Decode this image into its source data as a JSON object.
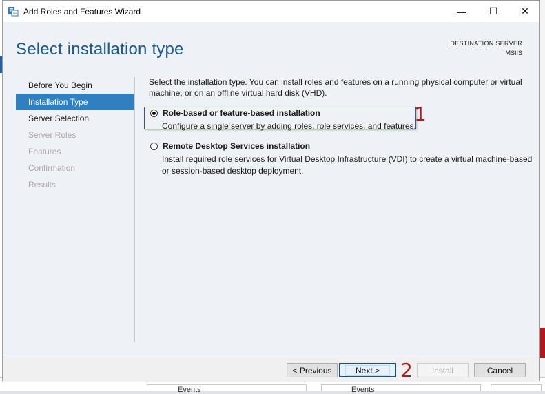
{
  "window": {
    "title": "Add Roles and Features Wizard",
    "controls": {
      "minimize": "—",
      "maximize": "☐",
      "close": "✕"
    }
  },
  "header": {
    "page_title": "Select installation type",
    "destination_label": "DESTINATION SERVER",
    "destination_name": "MSIIS"
  },
  "nav": {
    "items": [
      {
        "label": "Before You Begin",
        "state": "done"
      },
      {
        "label": "Installation Type",
        "state": "active"
      },
      {
        "label": "Server Selection",
        "state": "current"
      },
      {
        "label": "Server Roles",
        "state": "disabled"
      },
      {
        "label": "Features",
        "state": "disabled"
      },
      {
        "label": "Confirmation",
        "state": "disabled"
      },
      {
        "label": "Results",
        "state": "disabled"
      }
    ]
  },
  "main": {
    "intro": "Select the installation type. You can install roles and features on a running physical computer or virtual machine, or on an offline virtual hard disk (VHD).",
    "options": [
      {
        "title": "Role-based or feature-based installation",
        "description": "Configure a single server by adding roles, role services, and features.",
        "selected": true
      },
      {
        "title": "Remote Desktop Services installation",
        "description": "Install required role services for Virtual Desktop Infrastructure (VDI) to create a virtual machine-based or session-based desktop deployment.",
        "selected": false
      }
    ]
  },
  "annotations": {
    "step1": "1",
    "step2": "2",
    "color": "#b3161b"
  },
  "buttons": {
    "previous": "< Previous",
    "next": "Next >",
    "install": "Install",
    "cancel": "Cancel"
  },
  "background": {
    "columns": [
      "Events",
      "Events"
    ]
  },
  "colors": {
    "accent": "#2f7fc1",
    "title": "#1c5a8f"
  }
}
